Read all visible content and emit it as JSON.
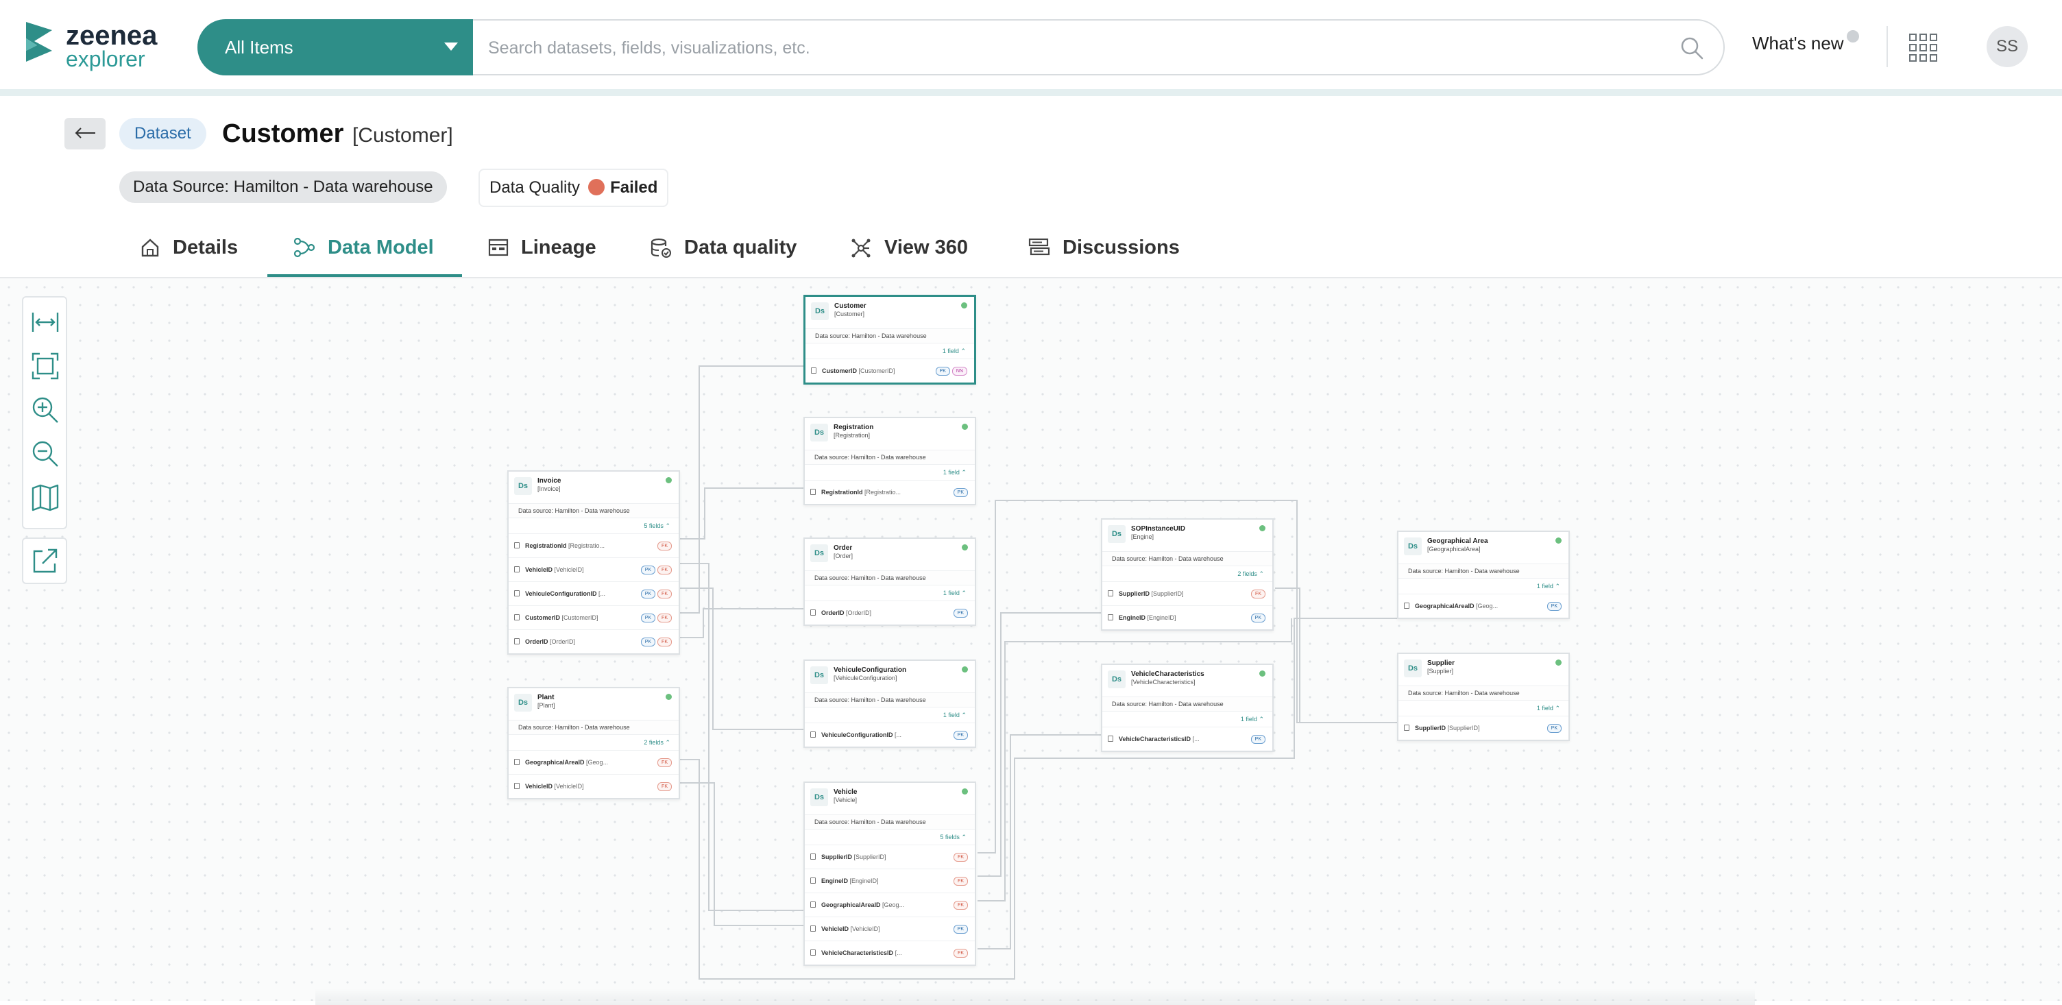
{
  "app": {
    "name": "zeenea",
    "sub": "explorer"
  },
  "search": {
    "scope": "All Items",
    "placeholder": "Search datasets, fields, visualizations, etc."
  },
  "header": {
    "whats_new": "What's new",
    "avatar": "SS"
  },
  "dataset": {
    "type": "Dataset",
    "name": "Customer",
    "technical_name": "[Customer]",
    "source_label": "Data Source:",
    "source_value": "Hamilton - Data warehouse",
    "dq_label": "Data Quality",
    "dq_value": "Failed",
    "dq_color": "#e0705a"
  },
  "tabs": [
    {
      "label": "Details",
      "icon": "home-icon"
    },
    {
      "label": "Data Model",
      "icon": "data-model-icon",
      "active": true
    },
    {
      "label": "Lineage",
      "icon": "lineage-icon"
    },
    {
      "label": "Data quality",
      "icon": "data-quality-icon"
    },
    {
      "label": "View 360",
      "icon": "view-360-icon"
    },
    {
      "label": "Discussions",
      "icon": "discussions-icon"
    }
  ],
  "toolbar": [
    "fit-width-icon",
    "fit-screen-icon",
    "zoom-in-icon",
    "zoom-out-icon",
    "minimap-icon",
    "export-icon"
  ],
  "nodes": {
    "customer": {
      "name": "Customer",
      "tech": "[Customer]",
      "source": "Data source: Hamilton - Data warehouse",
      "count": "1 field",
      "fields": [
        {
          "name": "CustomerID",
          "tech": "[CustomerID]",
          "keys": [
            "PK",
            "NN"
          ]
        }
      ]
    },
    "registration": {
      "name": "Registration",
      "tech": "[Registration]",
      "source": "Data source: Hamilton - Data warehouse",
      "count": "1 field",
      "fields": [
        {
          "name": "RegistrationId",
          "tech": "[Registratio...",
          "keys": [
            "PK"
          ]
        }
      ]
    },
    "order": {
      "name": "Order",
      "tech": "[Order]",
      "source": "Data source: Hamilton - Data warehouse",
      "count": "1 field",
      "fields": [
        {
          "name": "OrderID",
          "tech": "[OrderID]",
          "keys": [
            "PK"
          ]
        }
      ]
    },
    "vehicule_configuration": {
      "name": "VehiculeConfiguration",
      "tech": "[VehiculeConfiguration]",
      "source": "Data source: Hamilton - Data warehouse",
      "count": "1 field",
      "fields": [
        {
          "name": "VehiculeConfigurationID",
          "tech": "[...",
          "keys": [
            "PK"
          ]
        }
      ]
    },
    "vehicle": {
      "name": "Vehicle",
      "tech": "[Vehicle]",
      "source": "Data source: Hamilton - Data warehouse",
      "count": "5 fields",
      "fields": [
        {
          "name": "SupplierID",
          "tech": "[SupplierID]",
          "keys": [
            "FK"
          ]
        },
        {
          "name": "EngineID",
          "tech": "[EngineID]",
          "keys": [
            "FK"
          ]
        },
        {
          "name": "GeographicalAreaID",
          "tech": "[Geog...",
          "keys": [
            "FK"
          ]
        },
        {
          "name": "VehicleID",
          "tech": "[VehicleID]",
          "keys": [
            "PK"
          ]
        },
        {
          "name": "VehicleCharacteristicsID",
          "tech": "[...",
          "keys": [
            "FK"
          ]
        }
      ]
    },
    "invoice": {
      "name": "Invoice",
      "tech": "[Invoice]",
      "source": "Data source: Hamilton - Data warehouse",
      "count": "5 fields",
      "fields": [
        {
          "name": "RegistrationId",
          "tech": "[Registratio...",
          "keys": [
            "FK"
          ]
        },
        {
          "name": "VehicleID",
          "tech": "[VehicleID]",
          "keys": [
            "PK",
            "FK"
          ]
        },
        {
          "name": "VehiculeConfigurationID",
          "tech": "[...",
          "keys": [
            "PK",
            "FK"
          ]
        },
        {
          "name": "CustomerID",
          "tech": "[CustomerID]",
          "keys": [
            "PK",
            "FK"
          ]
        },
        {
          "name": "OrderID",
          "tech": "[OrderID]",
          "keys": [
            "PK",
            "FK"
          ]
        }
      ]
    },
    "plant": {
      "name": "Plant",
      "tech": "[Plant]",
      "source": "Data source: Hamilton - Data warehouse",
      "count": "2 fields",
      "fields": [
        {
          "name": "GeographicalAreaID",
          "tech": "[Geog...",
          "keys": [
            "FK"
          ]
        },
        {
          "name": "VehicleID",
          "tech": "[VehicleID]",
          "keys": [
            "FK"
          ]
        }
      ]
    },
    "sop_instance": {
      "name": "SOPInstanceUID",
      "tech": "[Engine]",
      "source": "Data source: Hamilton - Data warehouse",
      "count": "2 fields",
      "fields": [
        {
          "name": "SupplierID",
          "tech": "[SupplierID]",
          "keys": [
            "FK"
          ]
        },
        {
          "name": "EngineID",
          "tech": "[EngineID]",
          "keys": [
            "PK"
          ]
        }
      ]
    },
    "vehicle_characteristics": {
      "name": "VehicleCharacteristics",
      "tech": "[VehicleCharacteristics]",
      "source": "Data source: Hamilton - Data warehouse",
      "count": "1 field",
      "fields": [
        {
          "name": "VehicleCharacteristicsID",
          "tech": "[...",
          "keys": [
            "PK"
          ]
        }
      ]
    },
    "geographical_area": {
      "name": "Geographical Area",
      "tech": "[GeographicalArea]",
      "source": "Data source: Hamilton - Data warehouse",
      "count": "1 field",
      "fields": [
        {
          "name": "GeographicalAreaID",
          "tech": "[Geog...",
          "keys": [
            "PK"
          ]
        }
      ]
    },
    "supplier": {
      "name": "Supplier",
      "tech": "[Supplier]",
      "source": "Data source: Hamilton - Data warehouse",
      "count": "1 field",
      "fields": [
        {
          "name": "SupplierID",
          "tech": "[SupplierID]",
          "keys": [
            "PK"
          ]
        }
      ]
    }
  }
}
